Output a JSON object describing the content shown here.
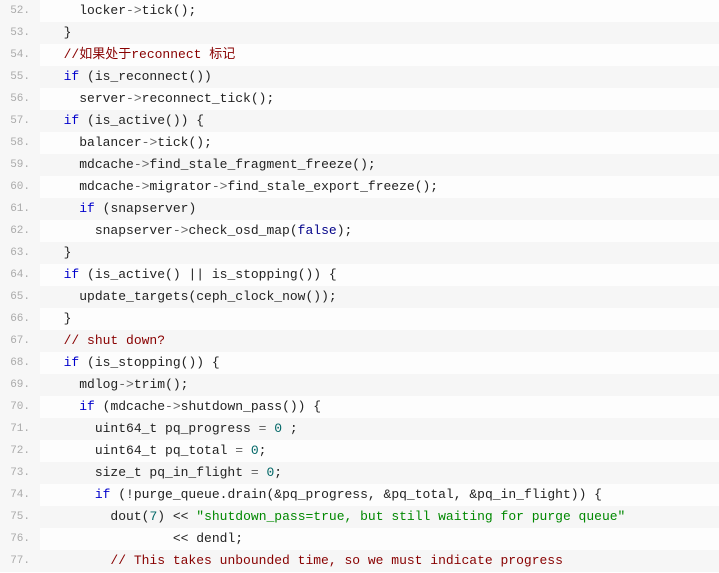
{
  "lines": [
    {
      "num": "52.",
      "indent": 4,
      "tokens": [
        [
          "ident",
          "locker"
        ],
        [
          "operator",
          "->"
        ],
        [
          "ident",
          "tick"
        ],
        [
          "punct",
          "();"
        ]
      ]
    },
    {
      "num": "53.",
      "indent": 2,
      "tokens": [
        [
          "punct",
          "}"
        ]
      ]
    },
    {
      "num": "54.",
      "indent": 2,
      "tokens": [
        [
          "comment",
          "//如果处于reconnect 标记"
        ]
      ]
    },
    {
      "num": "55.",
      "indent": 2,
      "tokens": [
        [
          "keyword",
          "if"
        ],
        [
          "punct",
          " ("
        ],
        [
          "ident",
          "is_reconnect"
        ],
        [
          "punct",
          "())"
        ]
      ]
    },
    {
      "num": "56.",
      "indent": 4,
      "tokens": [
        [
          "ident",
          "server"
        ],
        [
          "operator",
          "->"
        ],
        [
          "ident",
          "reconnect_tick"
        ],
        [
          "punct",
          "();"
        ]
      ]
    },
    {
      "num": "57.",
      "indent": 2,
      "tokens": [
        [
          "keyword",
          "if"
        ],
        [
          "punct",
          " ("
        ],
        [
          "ident",
          "is_active"
        ],
        [
          "punct",
          "()) {"
        ]
      ]
    },
    {
      "num": "58.",
      "indent": 4,
      "tokens": [
        [
          "ident",
          "balancer"
        ],
        [
          "operator",
          "->"
        ],
        [
          "ident",
          "tick"
        ],
        [
          "punct",
          "();"
        ]
      ]
    },
    {
      "num": "59.",
      "indent": 4,
      "tokens": [
        [
          "ident",
          "mdcache"
        ],
        [
          "operator",
          "->"
        ],
        [
          "ident",
          "find_stale_fragment_freeze"
        ],
        [
          "punct",
          "();"
        ]
      ]
    },
    {
      "num": "60.",
      "indent": 4,
      "tokens": [
        [
          "ident",
          "mdcache"
        ],
        [
          "operator",
          "->"
        ],
        [
          "ident",
          "migrator"
        ],
        [
          "operator",
          "->"
        ],
        [
          "ident",
          "find_stale_export_freeze"
        ],
        [
          "punct",
          "();"
        ]
      ]
    },
    {
      "num": "61.",
      "indent": 4,
      "tokens": [
        [
          "keyword",
          "if"
        ],
        [
          "punct",
          " ("
        ],
        [
          "ident",
          "snapserver"
        ],
        [
          "punct",
          ")"
        ]
      ]
    },
    {
      "num": "62.",
      "indent": 6,
      "tokens": [
        [
          "ident",
          "snapserver"
        ],
        [
          "operator",
          "->"
        ],
        [
          "ident",
          "check_osd_map"
        ],
        [
          "punct",
          "("
        ],
        [
          "boolean",
          "false"
        ],
        [
          "punct",
          ");"
        ]
      ]
    },
    {
      "num": "63.",
      "indent": 2,
      "tokens": [
        [
          "punct",
          "}"
        ]
      ]
    },
    {
      "num": "64.",
      "indent": 2,
      "tokens": [
        [
          "keyword",
          "if"
        ],
        [
          "punct",
          " ("
        ],
        [
          "ident",
          "is_active"
        ],
        [
          "punct",
          "() || "
        ],
        [
          "ident",
          "is_stopping"
        ],
        [
          "punct",
          "()) {"
        ]
      ]
    },
    {
      "num": "65.",
      "indent": 4,
      "tokens": [
        [
          "ident",
          "update_targets"
        ],
        [
          "punct",
          "("
        ],
        [
          "ident",
          "ceph_clock_now"
        ],
        [
          "punct",
          "());"
        ]
      ]
    },
    {
      "num": "66.",
      "indent": 2,
      "tokens": [
        [
          "punct",
          "}"
        ]
      ]
    },
    {
      "num": "67.",
      "indent": 2,
      "tokens": [
        [
          "comment",
          "// shut down?"
        ]
      ]
    },
    {
      "num": "68.",
      "indent": 2,
      "tokens": [
        [
          "keyword",
          "if"
        ],
        [
          "punct",
          " ("
        ],
        [
          "ident",
          "is_stopping"
        ],
        [
          "punct",
          "()) {"
        ]
      ]
    },
    {
      "num": "69.",
      "indent": 4,
      "tokens": [
        [
          "ident",
          "mdlog"
        ],
        [
          "operator",
          "->"
        ],
        [
          "ident",
          "trim"
        ],
        [
          "punct",
          "();"
        ]
      ]
    },
    {
      "num": "70.",
      "indent": 4,
      "tokens": [
        [
          "keyword",
          "if"
        ],
        [
          "punct",
          " ("
        ],
        [
          "ident",
          "mdcache"
        ],
        [
          "operator",
          "->"
        ],
        [
          "ident",
          "shutdown_pass"
        ],
        [
          "punct",
          "()) {"
        ]
      ]
    },
    {
      "num": "71.",
      "indent": 6,
      "tokens": [
        [
          "ident",
          "uint64_t pq_progress "
        ],
        [
          "operator",
          "= "
        ],
        [
          "number",
          "0"
        ],
        [
          "punct",
          " ;"
        ]
      ]
    },
    {
      "num": "72.",
      "indent": 6,
      "tokens": [
        [
          "ident",
          "uint64_t pq_total "
        ],
        [
          "operator",
          "= "
        ],
        [
          "number",
          "0"
        ],
        [
          "punct",
          ";"
        ]
      ]
    },
    {
      "num": "73.",
      "indent": 6,
      "tokens": [
        [
          "ident",
          "size_t pq_in_flight "
        ],
        [
          "operator",
          "= "
        ],
        [
          "number",
          "0"
        ],
        [
          "punct",
          ";"
        ]
      ]
    },
    {
      "num": "74.",
      "indent": 6,
      "tokens": [
        [
          "keyword",
          "if"
        ],
        [
          "punct",
          " (!"
        ],
        [
          "ident",
          "purge_queue"
        ],
        [
          "punct",
          "."
        ],
        [
          "ident",
          "drain"
        ],
        [
          "punct",
          "(&"
        ],
        [
          "ident",
          "pq_progress"
        ],
        [
          "punct",
          ", &"
        ],
        [
          "ident",
          "pq_total"
        ],
        [
          "punct",
          ", &"
        ],
        [
          "ident",
          "pq_in_flight"
        ],
        [
          "punct",
          ")) {"
        ]
      ]
    },
    {
      "num": "75.",
      "indent": 8,
      "tokens": [
        [
          "ident",
          "dout"
        ],
        [
          "punct",
          "("
        ],
        [
          "number",
          "7"
        ],
        [
          "punct",
          ") << "
        ],
        [
          "string",
          "\"shutdown_pass=true, but still waiting for purge queue\""
        ]
      ]
    },
    {
      "num": "76.",
      "indent": 16,
      "tokens": [
        [
          "punct",
          "<< "
        ],
        [
          "ident",
          "dendl"
        ],
        [
          "punct",
          ";"
        ]
      ]
    },
    {
      "num": "77.",
      "indent": 8,
      "tokens": [
        [
          "comment",
          "// This takes unbounded time, so we must indicate progress"
        ]
      ]
    }
  ]
}
